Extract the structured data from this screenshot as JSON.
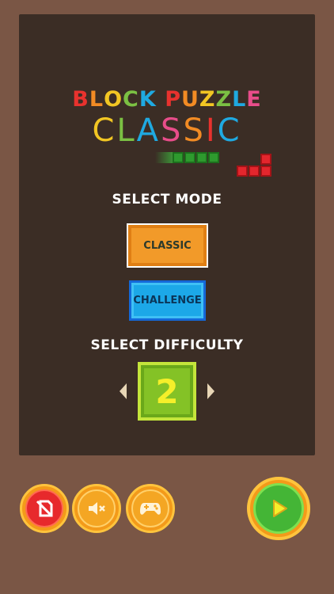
{
  "title": {
    "line1": [
      "B",
      "L",
      "O",
      "C",
      "K",
      " ",
      "P",
      "U",
      "Z",
      "Z",
      "L",
      "E"
    ],
    "line1_colors": [
      "#e8322e",
      "#f28b24",
      "#f2c623",
      "#7bc043",
      "#1fa9e1",
      "#ffffff",
      "#e8322e",
      "#f28b24",
      "#f2c623",
      "#7bc043",
      "#1fa9e1",
      "#e84d8a"
    ],
    "line2": [
      "C",
      "L",
      "A",
      "S",
      "S",
      "I",
      "C"
    ],
    "line2_colors": [
      "#f2c623",
      "#7bc043",
      "#1fa9e1",
      "#e84d8a",
      "#f28b24",
      "#e8322e",
      "#1fa9e1"
    ]
  },
  "select_mode_label": "SELECT MODE",
  "modes": {
    "classic": "CLASSIC",
    "challenge": "CHALLENGE"
  },
  "select_difficulty_label": "SELECT DIFFICULTY",
  "difficulty": "2",
  "icons": {
    "decrease": "chevron-left-icon",
    "increase": "chevron-right-icon",
    "no_ads": "no-ads-icon",
    "sound": "mute-icon",
    "games": "gamepad-icon",
    "play": "play-icon"
  },
  "colors": {
    "background": "#7a5645",
    "panel": "#3b2d25",
    "classic_button": "#f29a29",
    "challenge_button": "#1ca8e8",
    "difficulty_box": "#84c226",
    "play_button": "#44b536"
  }
}
